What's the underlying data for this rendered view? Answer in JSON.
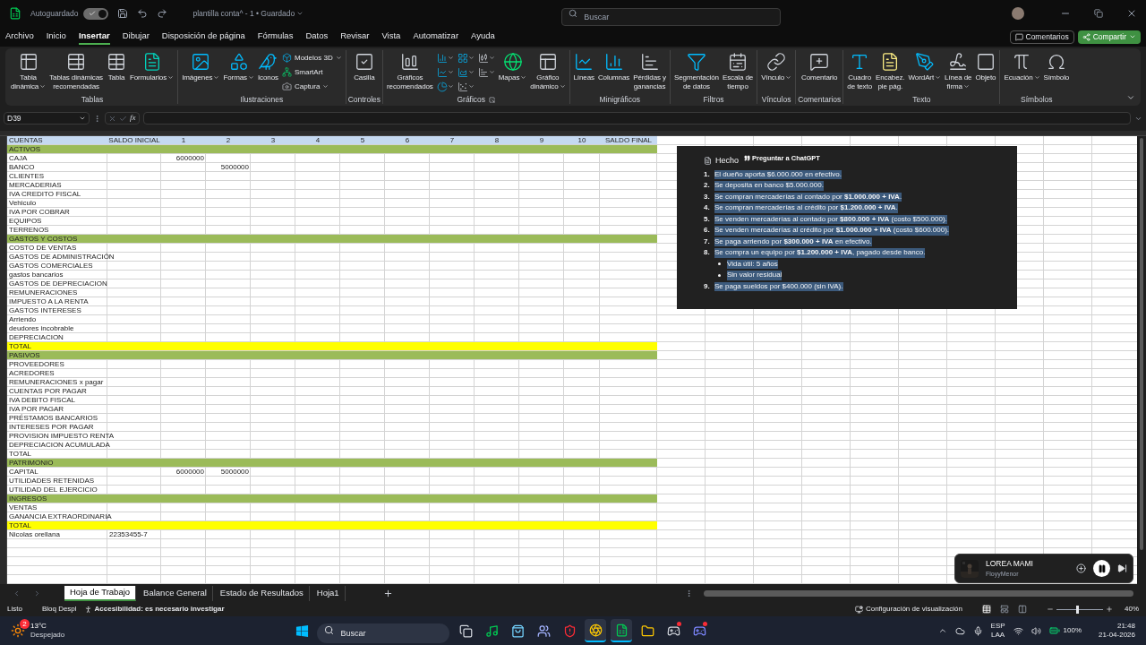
{
  "title_bar": {
    "autosave_label": "Autoguardado",
    "autosave_on": true,
    "document": "plantilla conta^ - 1 • Guardado",
    "search": {
      "placeholder": "Buscar"
    }
  },
  "menu_tabs": [
    {
      "label": "Archivo",
      "selected": false
    },
    {
      "label": "Inicio",
      "selected": false
    },
    {
      "label": "Insertar",
      "selected": true
    },
    {
      "label": "Dibujar",
      "selected": false
    },
    {
      "label": "Disposición de página",
      "selected": false
    },
    {
      "label": "Fórmulas",
      "selected": false
    },
    {
      "label": "Datos",
      "selected": false
    },
    {
      "label": "Revisar",
      "selected": false
    },
    {
      "label": "Vista",
      "selected": false
    },
    {
      "label": "Automatizar",
      "selected": false
    },
    {
      "label": "Ayuda",
      "selected": false
    }
  ],
  "comments_button": "Comentarios",
  "share_button": "Compartir",
  "ribbon": {
    "groups": [
      {
        "label": "Tablas",
        "items": [
          {
            "kind": "large",
            "label": "Tabla\ndinámica",
            "dropdown": true
          },
          {
            "kind": "large",
            "label": "Tablas dinámicas\nrecomendadas"
          },
          {
            "kind": "large",
            "label": "Tabla"
          },
          {
            "kind": "large",
            "label": "Formularios",
            "dropdown": true
          }
        ]
      },
      {
        "label": "Ilustraciones",
        "items": [
          {
            "kind": "large",
            "label": "Imágenes",
            "dropdown": true
          },
          {
            "kind": "large",
            "label": "Formas",
            "dropdown": true
          },
          {
            "kind": "large",
            "label": "Iconos"
          },
          {
            "kind": "small",
            "label": "Modelos 3D",
            "dropdown": true
          },
          {
            "kind": "small",
            "label": "SmartArt"
          },
          {
            "kind": "small",
            "label": "Captura",
            "dropdown": true
          }
        ]
      },
      {
        "label": "Controles",
        "items": [
          {
            "kind": "large",
            "label": "Casilla"
          }
        ]
      },
      {
        "label": "Gráficos",
        "launcher": true,
        "items": [
          {
            "kind": "large",
            "label": "Gráficos\nrecomendados"
          },
          {
            "kind": "icon",
            "dropdown": true
          },
          {
            "kind": "icon",
            "dropdown": true
          },
          {
            "kind": "icon",
            "dropdown": true
          },
          {
            "kind": "icon",
            "dropdown": true
          },
          {
            "kind": "icon",
            "dropdown": true
          },
          {
            "kind": "icon",
            "dropdown": true
          },
          {
            "kind": "icon",
            "dropdown": true
          },
          {
            "kind": "icon",
            "dropdown": true
          },
          {
            "kind": "large",
            "label": "Mapas",
            "dropdown": true
          },
          {
            "kind": "large",
            "label": "Gráfico\ndinámico",
            "dropdown": true
          }
        ]
      },
      {
        "label": "Minigráficos",
        "items": [
          {
            "kind": "large",
            "label": "Líneas"
          },
          {
            "kind": "large",
            "label": "Columnas"
          },
          {
            "kind": "large",
            "label": "Pérdidas y\nganancias"
          }
        ]
      },
      {
        "label": "Filtros",
        "items": [
          {
            "kind": "large",
            "label": "Segmentación\nde datos"
          },
          {
            "kind": "large",
            "label": "Escala de\ntiempo"
          }
        ]
      },
      {
        "label": "Vínculos",
        "items": [
          {
            "kind": "large",
            "label": "Vínculo",
            "dropdown": true
          }
        ]
      },
      {
        "label": "Comentarios",
        "items": [
          {
            "kind": "large",
            "label": "Comentario"
          }
        ]
      },
      {
        "label": "Texto",
        "items": [
          {
            "kind": "large",
            "label": "Cuadro\nde texto"
          },
          {
            "kind": "large",
            "label": "Encabez.\npie pág."
          },
          {
            "kind": "large",
            "label": "WordArt",
            "dropdown": true
          },
          {
            "kind": "large",
            "label": "Línea de\nfirma",
            "dropdown": true
          },
          {
            "kind": "large",
            "label": "Objeto"
          }
        ]
      },
      {
        "label": "Símbolos",
        "items": [
          {
            "kind": "large",
            "label": "Ecuación",
            "dropdown": true
          },
          {
            "kind": "large",
            "label": "Símbolo"
          }
        ]
      }
    ]
  },
  "formula_bar": {
    "name_box": "D39",
    "function_label": "fx"
  },
  "sheet": {
    "rows": [
      {
        "kind": "header",
        "account": "CUENTAS",
        "saldo_inicial": "SALDO INICIAL",
        "col_1": "1",
        "col_2": "2",
        "col_3": "3",
        "col_4": "4",
        "col_5": "5",
        "col_6": "6",
        "col_7": "7",
        "col_8": "8",
        "col_9": "9",
        "col_10": "10",
        "saldo_final": "SALDO FINAL"
      },
      {
        "kind": "section",
        "account": "ACTIVOS"
      },
      {
        "kind": "plain",
        "account": "CAJA",
        "col_1": "6000000"
      },
      {
        "kind": "plain",
        "account": "BANCO",
        "col_2": "5000000"
      },
      {
        "kind": "plain",
        "account": "CLIENTES"
      },
      {
        "kind": "plain",
        "account": "MERCADERIAS"
      },
      {
        "kind": "plain",
        "account": "IVA CREDITO FISCAL"
      },
      {
        "kind": "plain",
        "account": "Vehiculo"
      },
      {
        "kind": "plain",
        "account": "IVA POR COBRAR"
      },
      {
        "kind": "plain",
        "account": "EQUIPOS"
      },
      {
        "kind": "plain",
        "account": "TERRENOS"
      },
      {
        "kind": "section",
        "account": "GASTOS Y COSTOS"
      },
      {
        "kind": "plain",
        "account": "COSTO DE VENTAS"
      },
      {
        "kind": "plain",
        "account": "GASTOS DE ADMINISTRACIÓN"
      },
      {
        "kind": "plain",
        "account": "GASTOS COMERCIALES"
      },
      {
        "kind": "plain",
        "account": "gastos bancarios"
      },
      {
        "kind": "plain",
        "account": "GASTOS DE DEPRECIACION"
      },
      {
        "kind": "plain",
        "account": "REMUNERACIONES"
      },
      {
        "kind": "plain",
        "account": "IMPUESTO A LA RENTA"
      },
      {
        "kind": "plain",
        "account": "GASTOS INTERESES"
      },
      {
        "kind": "plain",
        "account": "Arriendo"
      },
      {
        "kind": "plain",
        "account": "deudores incobrable"
      },
      {
        "kind": "plain",
        "account": "DEPRECIACION"
      },
      {
        "kind": "total",
        "account": "TOTAL"
      },
      {
        "kind": "section",
        "account": "PASIVOS"
      },
      {
        "kind": "plain",
        "account": "PROVEEDORES"
      },
      {
        "kind": "plain",
        "account": "ACREDORES"
      },
      {
        "kind": "plain",
        "account": "REMUNERACIONES x pagar"
      },
      {
        "kind": "plain",
        "account": "CUENTAS POR PAGAR"
      },
      {
        "kind": "plain",
        "account": "IVA DEBITO FISCAL"
      },
      {
        "kind": "plain",
        "account": "IVA POR PAGAR"
      },
      {
        "kind": "plain",
        "account": "PRÉSTAMOS BANCARIOS"
      },
      {
        "kind": "plain",
        "account": "INTERESES POR PAGAR"
      },
      {
        "kind": "plain",
        "account": "PROVISION IMPUESTO RENTA"
      },
      {
        "kind": "plain",
        "account": "DEPRECIACION ACUMULADA"
      },
      {
        "kind": "plain",
        "account": "TOTAL"
      },
      {
        "kind": "section",
        "account": "PATRIMONIO"
      },
      {
        "kind": "plain",
        "account": "CAPITAL",
        "col_1": "6000000",
        "col_2": "5000000"
      },
      {
        "kind": "plain",
        "account": "UTILIDADES RETENIDAS"
      },
      {
        "kind": "plain",
        "account": "UTILIDAD DEL EJERCICIO"
      },
      {
        "kind": "section",
        "account": "INGRESOS"
      },
      {
        "kind": "plain",
        "account": "VENTAS"
      },
      {
        "kind": "plain",
        "account": "GANANCIA EXTRAORDINARIA"
      },
      {
        "kind": "total",
        "account": "TOTAL"
      },
      {
        "kind": "plain",
        "account": "Nicolas orellana",
        "saldo_inicial": "22353455-7"
      }
    ]
  },
  "chat_popup": {
    "title": "Hecho",
    "tooltip": "Preguntar a ChatGPT",
    "items": [
      {
        "number": "1.",
        "text": "El dueño aporta $6.000.000 en efectivo."
      },
      {
        "number": "2.",
        "text": "Se deposita en banco $5.000.000."
      },
      {
        "number": "3.",
        "text": "Se compran mercaderías al contado por **$1.000.000 + IVA**."
      },
      {
        "number": "4.",
        "text": "Se compran mercaderías al crédito por **$1.200.000 + IVA**."
      },
      {
        "number": "5.",
        "text": "Se venden mercaderías al contado por **$800.000 + IVA** (costo $500.000)."
      },
      {
        "number": "6.",
        "text": "Se venden mercaderías al crédito por **$1.000.000 + IVA** (costo $600.000)."
      },
      {
        "number": "7.",
        "text": "Se paga arriendo por **$300.000 + IVA** en efectivo."
      },
      {
        "number": "8.",
        "text": "Se compra un equipo por **$1.200.000 + IVA**, pagado desde banco.",
        "children": [
          {
            "text": "Vida útil: 5 años"
          },
          {
            "text": "Sin valor residual"
          }
        ]
      },
      {
        "number": "9.",
        "text": "Se paga sueldos por $400.000 (sin IVA)."
      }
    ]
  },
  "sheet_tabs": [
    {
      "label": "Hoja de Trabajo",
      "selected": true
    },
    {
      "label": "Balance General",
      "selected": false
    },
    {
      "label": "Estado de Resultados",
      "selected": false
    },
    {
      "label": "Hoja1",
      "selected": false
    }
  ],
  "status_bar": {
    "ready": "Listo",
    "scroll_lock": "Bloq Despl",
    "accessibility": "Accesibilidad: es necesario investigar",
    "display_settings": "Configuración de visualización",
    "views": [
      {
        "selected": true
      },
      {
        "selected": false
      },
      {
        "selected": false
      }
    ],
    "zoom": {
      "level": 0.45,
      "reading": "40%"
    }
  },
  "media": {
    "title": "LOREA MAMI",
    "artist": "FloyyMenor",
    "playing": true
  },
  "taskbar": {
    "weather": {
      "temperature": "13°C",
      "condition": "Despejado",
      "badge": "2"
    },
    "search": {
      "placeholder": "Buscar"
    },
    "apps": [
      {
        "selected": false,
        "notification": false
      },
      {
        "selected": false,
        "notification": false
      },
      {
        "selected": false,
        "notification": false
      },
      {
        "selected": false,
        "notification": false
      },
      {
        "selected": false,
        "notification": false
      },
      {
        "selected": true,
        "notification": false
      },
      {
        "selected": true,
        "notification": false
      },
      {
        "selected": false,
        "notification": false
      },
      {
        "selected": false,
        "notification": true
      },
      {
        "selected": false,
        "notification": true
      }
    ],
    "language": "ESP",
    "layout": "LAA",
    "battery": "100%",
    "time": "21:48",
    "date": "21-04-2026"
  }
}
